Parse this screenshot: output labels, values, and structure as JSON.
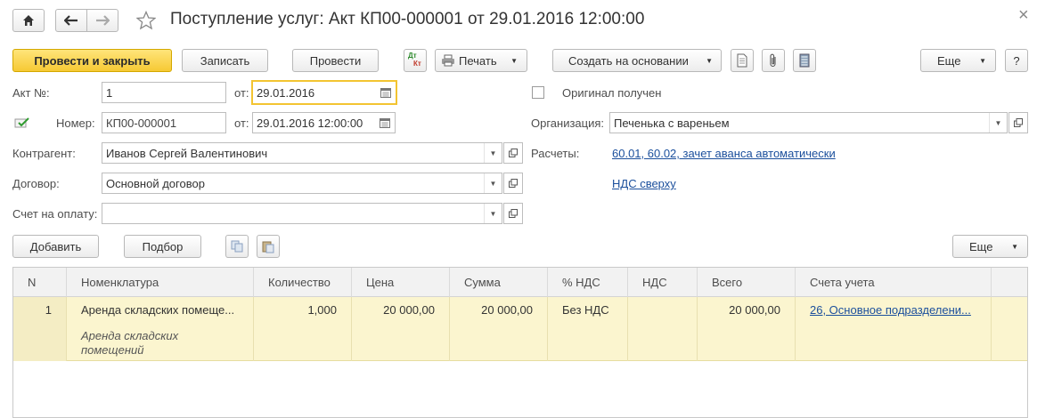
{
  "window": {
    "title": "Поступление услуг: Акт КП00-000001 от 29.01.2016 12:00:00",
    "close_glyph": "×"
  },
  "toolbar": {
    "post_close_label": "Провести и закрыть",
    "save_label": "Записать",
    "post_label": "Провести",
    "dtkt_top": "Дт",
    "dtkt_bottom": "Кт",
    "print_label": "Печать",
    "create_based_label": "Создать на основании",
    "more_label": "Еще",
    "help_label": "?"
  },
  "form": {
    "act_no_label": "Акт №:",
    "act_no_value": "1",
    "from_label": "от:",
    "act_date_value": "29.01.2016",
    "original_label": "Оригинал получен",
    "number_label": "Номер:",
    "number_value": "КП00-000001",
    "from2_label": "от:",
    "number_date_value": "29.01.2016 12:00:00",
    "org_label": "Организация:",
    "org_value": "Печенька с вареньем",
    "counterparty_label": "Контрагент:",
    "counterparty_value": "Иванов Сергей Валентинович",
    "settlements_label": "Расчеты:",
    "settlements_link": "60.01, 60.02, зачет аванса автоматически",
    "contract_label": "Договор:",
    "contract_value": "Основной договор",
    "vat_link": "НДС сверху",
    "invoice_label": "Счет на оплату:",
    "invoice_value": ""
  },
  "table_toolbar": {
    "add_label": "Добавить",
    "pick_label": "Подбор",
    "more_label": "Еще"
  },
  "table": {
    "headers": [
      "N",
      "Номенклатура",
      "Количество",
      "Цена",
      "Сумма",
      "% НДС",
      "НДС",
      "Всего",
      "Счета учета"
    ],
    "rows": [
      {
        "n": "1",
        "item": "Аренда складских помеще...",
        "item_desc_line1": "Аренда складских",
        "item_desc_line2": "помещений",
        "qty": "1,000",
        "price": "20 000,00",
        "sum": "20 000,00",
        "vat_rate": "Без НДС",
        "vat": "",
        "total": "20 000,00",
        "accounts": "26, Основное подразделени..."
      }
    ]
  },
  "colors": {
    "primary_button": "#f6c934",
    "link": "#1b4f9c",
    "selected_row": "#fbf5cf",
    "focus_border": "#f3c431"
  },
  "icons": [
    "home-icon",
    "back-arrow-icon",
    "forward-arrow-icon",
    "star-icon",
    "printer-icon",
    "document-icon",
    "paperclip-icon",
    "list-icon",
    "copy-icon",
    "paste-icon",
    "calendar-icon",
    "dropdown-icon",
    "open-icon",
    "checkmark-icon"
  ]
}
